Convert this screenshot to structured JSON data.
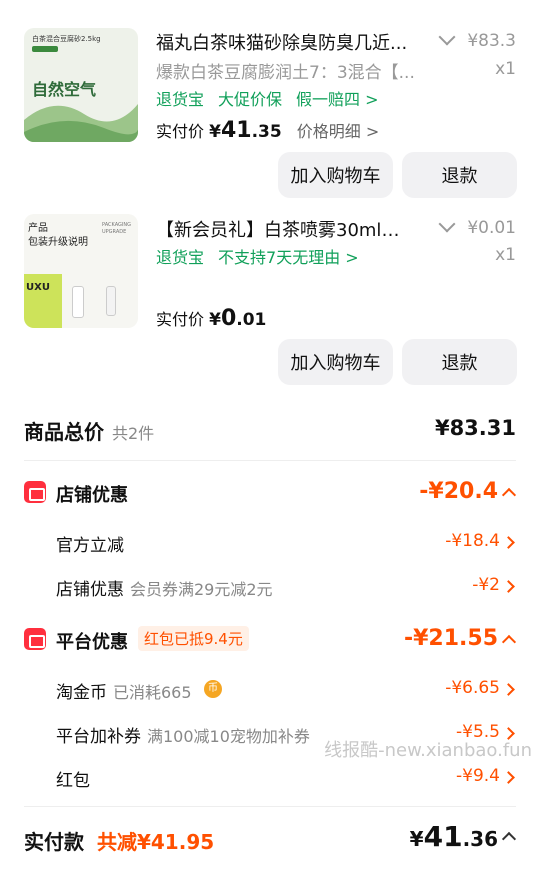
{
  "items": [
    {
      "thumb_text_top": "白茶混合豆腐砂2.5kg",
      "thumb_text_main": "自然空气",
      "title": "福丸白茶味猫砂除臭防臭几近...",
      "sku": "爆款白茶豆腐膨润土7：3混合【...",
      "price": "¥83.3",
      "qty": "x1",
      "services": [
        "退货宝",
        "大促价保",
        "假一赔四 >"
      ],
      "actual_label": "实付价",
      "actual_currency": "¥",
      "actual_int": "41",
      "actual_dec": ".35",
      "detail_link": "价格明细 >",
      "btn_cart": "加入购物车",
      "btn_refund": "退款"
    },
    {
      "thumb_text_top": "产品\n包装升级说明",
      "thumb_text_sub": "PACKAGING UPGRADE",
      "thumb_logo": "UXU",
      "title": "【新会员礼】白茶喷雾30ml，...",
      "price": "¥0.01",
      "qty": "x1",
      "services": [
        "退货宝",
        "不支持7天无理由 >"
      ],
      "actual_label": "实付价",
      "actual_currency": "¥",
      "actual_int": "0",
      "actual_dec": ".01",
      "btn_cart": "加入购物车",
      "btn_refund": "退款"
    }
  ],
  "summary": {
    "total_label": "商品总价",
    "total_count": "共2件",
    "total_value": "¥83.31",
    "shop_discount_label": "店铺优惠",
    "shop_discount_value": "-¥20.4",
    "official_cut_label": "官方立减",
    "official_cut_value": "-¥18.4",
    "shop_coupon_label": "店铺优惠",
    "shop_coupon_desc": "会员券满29元减2元",
    "shop_coupon_value": "-¥2",
    "platform_label": "平台优惠",
    "platform_tag": "红包已抵9.4元",
    "platform_value": "-¥21.55",
    "gold_label": "淘金币",
    "gold_desc": "已消耗665",
    "gold_value": "-¥6.65",
    "addon_label": "平台加补券",
    "addon_desc": "满100减10宠物加补券",
    "addon_value": "-¥5.5",
    "redpack_label": "红包",
    "redpack_value": "-¥9.4",
    "paid_label": "实付款",
    "paid_saved": "共减¥41.95",
    "paid_currency": "¥",
    "paid_int": "41",
    "paid_dec": ".36"
  },
  "watermark": "线报酷-new.xianbao.fun",
  "colors": {
    "accent": "#ff5000",
    "service_green": "#11a05a",
    "icon_red": "#ff2f3e"
  }
}
